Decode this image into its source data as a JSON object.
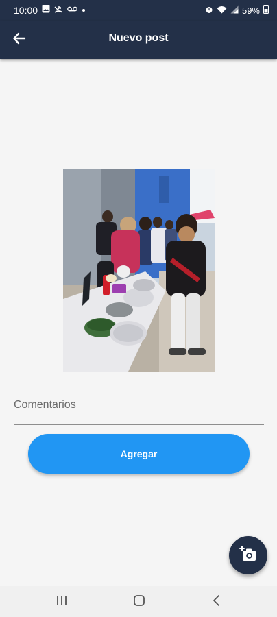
{
  "status_bar": {
    "time": "10:00",
    "battery": "59%",
    "icons": [
      "gallery-icon",
      "missed-call-icon",
      "voicemail-icon",
      "dot-icon",
      "alarm-icon",
      "wifi-icon",
      "signal-icon",
      "battery-icon"
    ]
  },
  "app_bar": {
    "title": "Nuevo post",
    "back_icon": "arrow-left-icon"
  },
  "form": {
    "comment_placeholder": "Comentarios",
    "comment_value": "",
    "submit_label": "Agregar"
  },
  "fab": {
    "icon": "add-photo-icon"
  },
  "nav_bar": {
    "buttons": [
      "recent-apps-icon",
      "home-icon",
      "back-icon"
    ]
  },
  "colors": {
    "app_bar": "#233048",
    "accent": "#2196f3",
    "background": "#f5f5f5"
  }
}
